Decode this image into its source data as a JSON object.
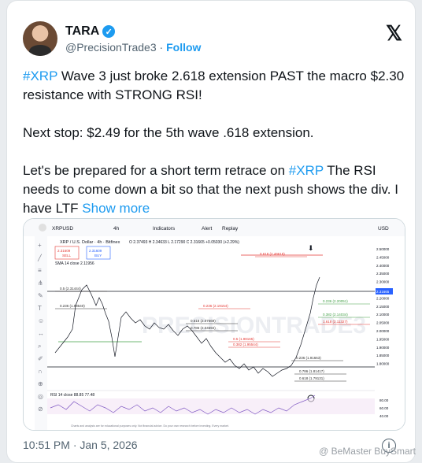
{
  "author": {
    "name": "TARA",
    "handle": "@PrecisionTrade3",
    "separator": "·",
    "follow_label": "Follow"
  },
  "tweet": {
    "p1_tag": "#XRP",
    "p1_text": " Wave 3 just broke 2.618 extension PAST the macro $2.30 resistance with STRONG RSI!",
    "p2_text": "Next stop: $2.49 for the 5th wave .618 extension.",
    "p3_text_a": "Let's be prepared for a short term retrace on ",
    "p3_tag": "#XRP",
    "p3_text_b": " The RSI needs to come down a bit so that the next push shows the div. I have LTF ",
    "show_more": "Show more"
  },
  "timestamp": "10:51 PM · Jan 5, 2026",
  "watermark": "@ BeMaster BuySmart",
  "chart_image": {
    "symbol": "XRPUSD",
    "title": "XRP / U.S. Dollar · 4h · Bitfinex",
    "toolbar": [
      "4h",
      "Indicators",
      "Alert",
      "Replay"
    ],
    "currency": "USD",
    "sell_price": "2.31609",
    "sell_label": "SELL",
    "buy_price": "2.31609",
    "buy_label": "BUY",
    "ohlc": "O 2.37493 H 2.34633 L 2.17290 C 2.31665 +0.05030 (+2.29%)",
    "sma_label": "SMA 14 close 2.11956",
    "rsi_label": "RSI 14 close 88.85 77.48",
    "y_axis": [
      "2.50000",
      "2.45000",
      "2.40000",
      "2.35000",
      "2.30000",
      "2.25000",
      "2.20000",
      "2.15000",
      "2.10000",
      "2.05000",
      "2.00000",
      "1.95000",
      "1.90000",
      "1.85000",
      "1.80000"
    ],
    "rsi_axis": [
      "80.00",
      "60.00",
      "40.00"
    ],
    "price_tag": "2.31665",
    "fib_labels": [
      {
        "text": "0.618 (2.49618)",
        "color": "#e53935"
      },
      {
        "text": "0.5 (2.31444)",
        "color": "#333333"
      },
      {
        "text": "0.236 (1.98540)",
        "color": "#333333"
      },
      {
        "text": "0.236 (2.19154)",
        "color": "#e53935"
      },
      {
        "text": "0.618 (2.07669)",
        "color": "#333333"
      },
      {
        "text": "0.786 (2.04594)",
        "color": "#333333"
      },
      {
        "text": "0.5 (1.98165)",
        "color": "#e53935"
      },
      {
        "text": "0.382 (1.95544)",
        "color": "#e53935"
      },
      {
        "text": "0.236 (1.91663)",
        "color": "#333333"
      },
      {
        "text": "0.786 (1.81417)",
        "color": "#333333"
      },
      {
        "text": "0.618 (1.79131)",
        "color": "#333333"
      },
      {
        "text": "1.618 (2.11327)",
        "color": "#e53935"
      },
      {
        "text": "0.382 (2.14034)",
        "color": "#43a047"
      },
      {
        "text": "0.236 (2.20051)",
        "color": "#43a047"
      }
    ],
    "watermark": "PRECISIONTRADE3",
    "disclaimer": "Charts and analysis are for educational purposes only. Not financial advice. Do your own research before investing. Every market."
  }
}
